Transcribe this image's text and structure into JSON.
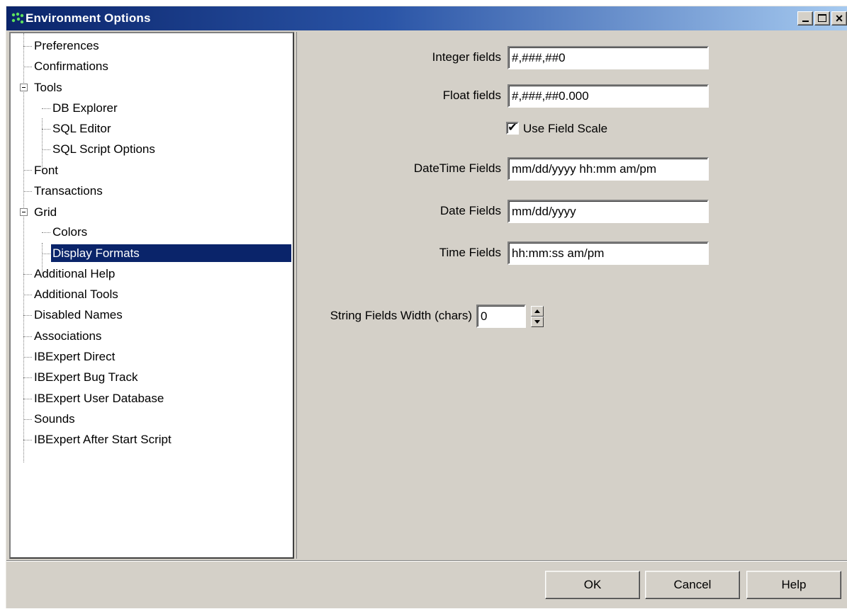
{
  "window": {
    "title": "Environment Options"
  },
  "tree": {
    "items": [
      {
        "label": "Preferences"
      },
      {
        "label": "Confirmations"
      },
      {
        "label": "Tools"
      },
      {
        "label": "DB Explorer"
      },
      {
        "label": "SQL Editor"
      },
      {
        "label": "SQL Script Options"
      },
      {
        "label": "Font"
      },
      {
        "label": "Transactions"
      },
      {
        "label": "Grid"
      },
      {
        "label": "Colors"
      },
      {
        "label": "Display Formats"
      },
      {
        "label": "Additional Help"
      },
      {
        "label": "Additional Tools"
      },
      {
        "label": "Disabled Names"
      },
      {
        "label": "Associations"
      },
      {
        "label": "IBExpert Direct"
      },
      {
        "label": "IBExpert Bug Track"
      },
      {
        "label": "IBExpert User Database"
      },
      {
        "label": "Sounds"
      },
      {
        "label": "IBExpert After Start Script"
      }
    ],
    "selected": "Display Formats"
  },
  "formats": {
    "integer_label": "Integer fields",
    "integer_value": "#,###,##0",
    "float_label": "Float fields",
    "float_value": "#,###,##0.000",
    "use_field_scale_label": "Use Field Scale",
    "use_field_scale_checked": "✔",
    "datetime_label": "DateTime Fields",
    "datetime_value": "mm/dd/yyyy  hh:mm am/pm",
    "date_label": "Date Fields",
    "date_value": "mm/dd/yyyy",
    "time_label": "Time Fields",
    "time_value": "hh:mm:ss am/pm",
    "string_width_label": "String Fields Width (chars)",
    "string_width_value": "0"
  },
  "buttons": {
    "ok": "OK",
    "cancel": "Cancel",
    "help": "Help"
  },
  "colors": {
    "titlebar": "#0a246a",
    "selection": "#0a246a",
    "face": "#d4d0c8"
  }
}
